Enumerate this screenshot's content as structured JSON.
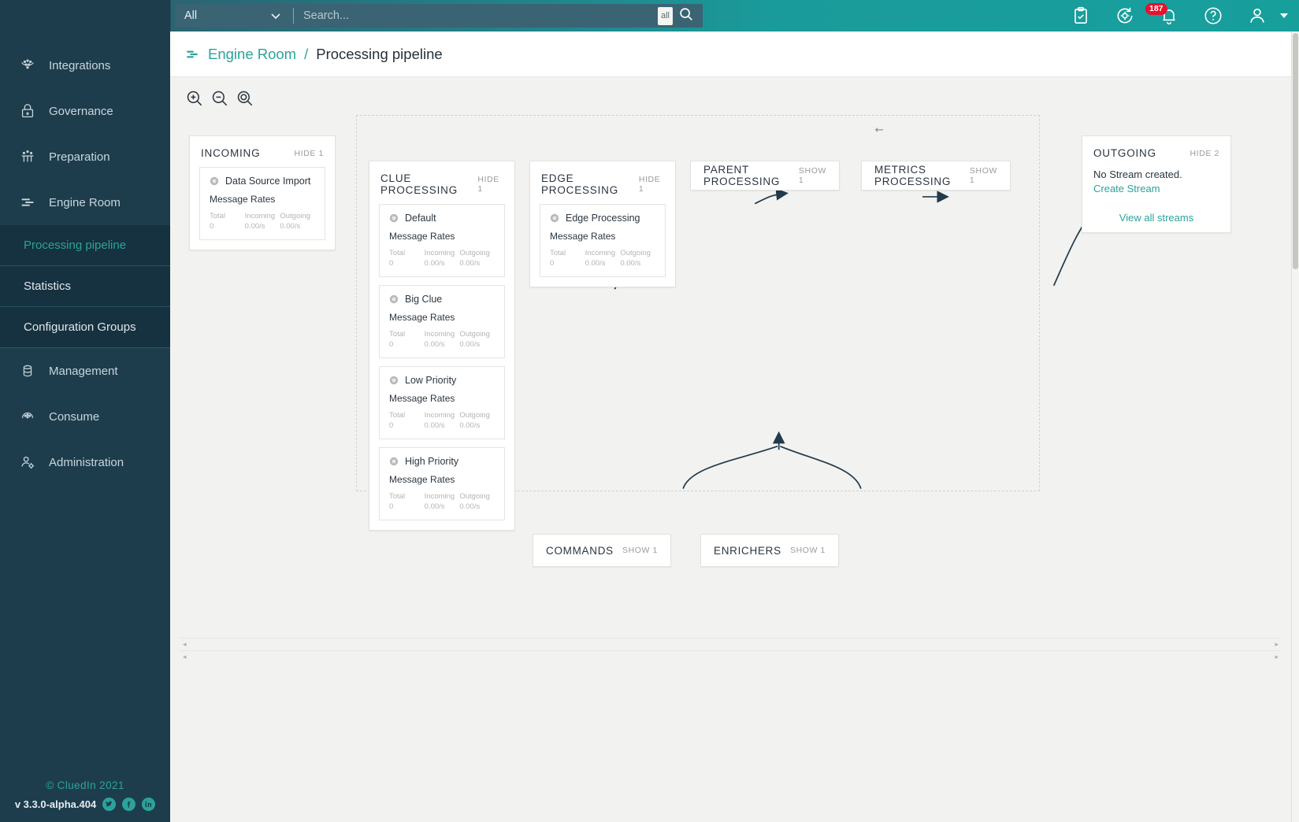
{
  "brand": {
    "name": "cluedin",
    "logo_icon": "cluedin-logo-icon"
  },
  "search": {
    "scope": "All",
    "placeholder": "Search...",
    "value": "",
    "chip": "all",
    "go_icon": "search-icon",
    "chevron_icon": "chevron-down-icon"
  },
  "topbar": {
    "icons": [
      {
        "name": "clipboard-check-icon",
        "badge": null
      },
      {
        "name": "sync-settings-icon",
        "badge": null
      },
      {
        "name": "notifications-bell-icon",
        "badge": "187"
      },
      {
        "name": "help-circle-icon",
        "badge": null
      },
      {
        "name": "user-account-icon",
        "badge": null
      }
    ],
    "badge_color": "#e8112d",
    "accent": "#18a6a0"
  },
  "sidebar": {
    "items": [
      {
        "label": "Integrations",
        "icon": "integrations-icon"
      },
      {
        "label": "Governance",
        "icon": "lock-shield-icon"
      },
      {
        "label": "Preparation",
        "icon": "preparation-icon"
      },
      {
        "label": "Engine Room",
        "icon": "engine-room-icon"
      },
      {
        "label": "Management",
        "icon": "database-icon"
      },
      {
        "label": "Consume",
        "icon": "consume-icon"
      },
      {
        "label": "Administration",
        "icon": "user-cog-icon"
      }
    ],
    "subitems": [
      {
        "label": "Processing pipeline",
        "active": true
      },
      {
        "label": "Statistics",
        "active": false
      },
      {
        "label": "Configuration Groups",
        "active": false
      }
    ],
    "footer": {
      "copyright": "© CluedIn  2021",
      "version": "v 3.3.0-alpha.404",
      "socials": [
        "twitter-icon",
        "facebook-icon",
        "linkedin-icon"
      ]
    }
  },
  "breadcrumb": {
    "icon": "engine-room-icon",
    "parent": "Engine Room",
    "separator": "/",
    "current": "Processing pipeline"
  },
  "zoom_controls": [
    {
      "name": "zoom-in-button",
      "icon": "zoom-in-icon"
    },
    {
      "name": "zoom-out-button",
      "icon": "zoom-out-icon"
    },
    {
      "name": "zoom-reset-button",
      "icon": "zoom-reset-icon"
    }
  ],
  "rates_labels": {
    "heading": "Message Rates",
    "total": "Total",
    "incoming": "Incoming",
    "outgoing": "Outgoing"
  },
  "pipeline": {
    "incoming": {
      "title": "INCOMING",
      "toggle": "HIDE 1",
      "streams": [
        {
          "name": "Data Source Import",
          "total": "0",
          "incoming": "0.00/s",
          "outgoing": "0.00/s"
        }
      ]
    },
    "clue_processing": {
      "title": "CLUE PROCESSING",
      "toggle": "HIDE 1",
      "streams": [
        {
          "name": "Default",
          "total": "0",
          "incoming": "0.00/s",
          "outgoing": "0.00/s"
        },
        {
          "name": "Big Clue",
          "total": "0",
          "incoming": "0.00/s",
          "outgoing": "0.00/s"
        },
        {
          "name": "Low Priority",
          "total": "0",
          "incoming": "0.00/s",
          "outgoing": "0.00/s"
        },
        {
          "name": "High Priority",
          "total": "0",
          "incoming": "0.00/s",
          "outgoing": "0.00/s"
        }
      ]
    },
    "edge_processing": {
      "title": "EDGE PROCESSING",
      "toggle": "HIDE 1",
      "streams": [
        {
          "name": "Edge Processing",
          "total": "0",
          "incoming": "0.00/s",
          "outgoing": "0.00/s"
        }
      ]
    },
    "parent_processing": {
      "title": "PARENT PROCESSING",
      "toggle": "SHOW 1"
    },
    "metrics_processing": {
      "title": "METRICS PROCESSING",
      "toggle": "SHOW 1"
    },
    "commands": {
      "title": "COMMANDS",
      "toggle": "SHOW 1"
    },
    "enrichers": {
      "title": "ENRICHERS",
      "toggle": "SHOW 1"
    },
    "outgoing": {
      "title": "OUTGOING",
      "toggle": "HIDE 2",
      "empty_text": "No Stream created.",
      "create_link": "Create Stream",
      "view_all_link": "View all streams"
    }
  },
  "scrollbars": {
    "left_arrow": "◂",
    "right_arrow": "▸"
  }
}
